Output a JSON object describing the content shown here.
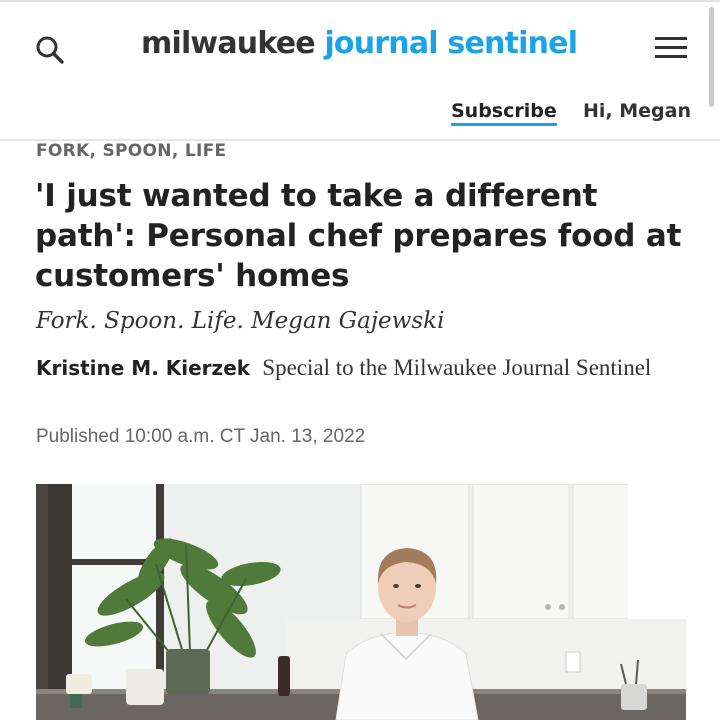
{
  "header": {
    "logo_part1": "milwaukee",
    "logo_part2": "journal sentinel",
    "subscribe_label": "Subscribe",
    "greeting": "Hi, Megan",
    "icons": {
      "search": "search-icon",
      "menu": "hamburger-menu-icon"
    },
    "colors": {
      "accent": "#1aa3e8",
      "text": "#333333"
    }
  },
  "article": {
    "section": "FORK, SPOON, LIFE",
    "headline": "'I just wanted to take a different path': Personal chef prepares food at customers' homes",
    "deck": "Fork. Spoon. Life. Megan Gajewski",
    "author": "Kristine M. Kierzek",
    "affiliation": "Special to the Milwaukee Journal Sentinel",
    "published": "Published 10:00 a.m. CT Jan. 13, 2022",
    "photo": "photo of chef in white jacket in a kitchen with plants"
  }
}
